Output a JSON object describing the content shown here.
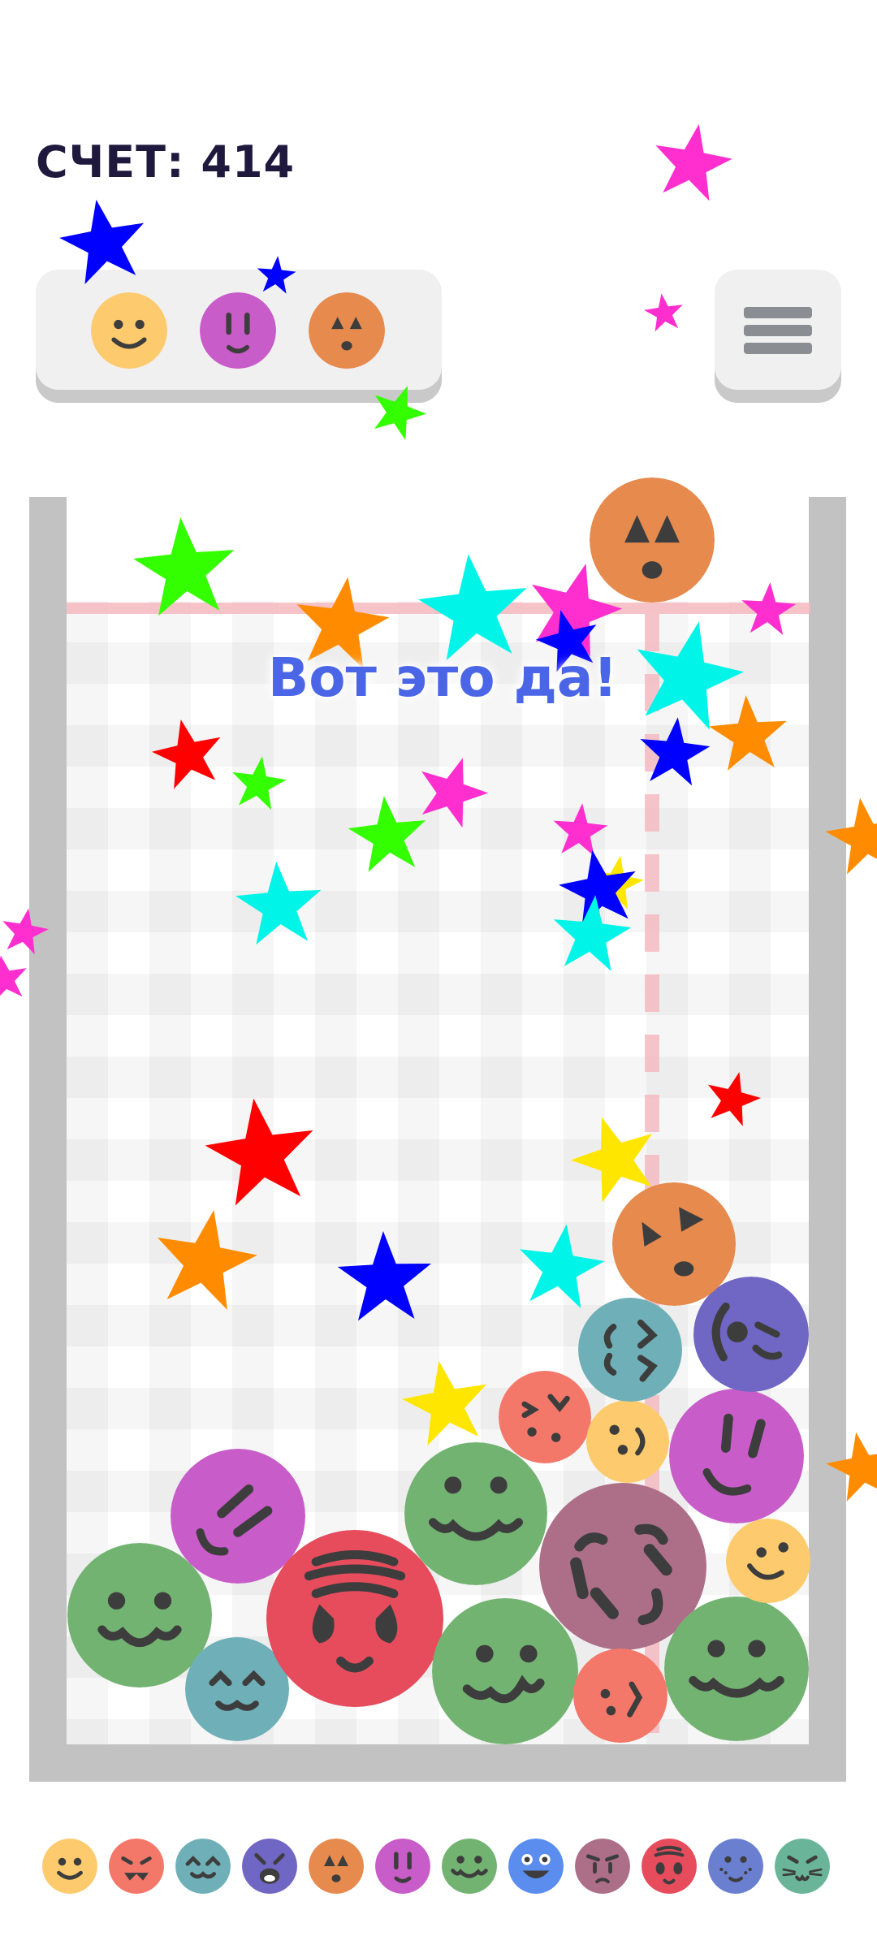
{
  "score": {
    "text": "СЧЕТ: 414"
  },
  "popup": {
    "text": "Вот это да!"
  },
  "next_queue": [
    {
      "name": "yellow-smile-face-icon",
      "color": "#fdcb6e"
    },
    {
      "name": "purple-face-icon",
      "color": "#c85cc8"
    },
    {
      "name": "orange-face-icon",
      "color": "#e68a4e"
    }
  ],
  "menu": {
    "icon": "hamburger-menu-icon"
  },
  "evolution_chain": [
    {
      "name": "yellow-smile-face-icon",
      "color": "#fdcb6e"
    },
    {
      "name": "salmon-fang-face-icon",
      "color": "#f4786a"
    },
    {
      "name": "teal-happy-face-icon",
      "color": "#6fb0b8"
    },
    {
      "name": "indigo-cat-face-icon",
      "color": "#7066c4"
    },
    {
      "name": "orange-triangle-face-icon",
      "color": "#e68a4e"
    },
    {
      "name": "purple-face-icon",
      "color": "#c85cc8"
    },
    {
      "name": "green-drool-face-icon",
      "color": "#72b372"
    },
    {
      "name": "blue-grin-face-icon",
      "color": "#5b8def"
    },
    {
      "name": "mauve-worried-face-icon",
      "color": "#ad6f88"
    },
    {
      "name": "red-panda-face-icon",
      "color": "#e64c5c"
    },
    {
      "name": "slate-freckle-face-icon",
      "color": "#6a7fcf"
    },
    {
      "name": "sea-green-cat-face-icon",
      "color": "#6ab59a"
    }
  ],
  "colors": {
    "background": "#ffffff",
    "score_text": "#1f1a3d",
    "popup_text": "#4a66e6",
    "container_wall": "#c2c2c2",
    "limit_line": "#f4b8bf"
  }
}
